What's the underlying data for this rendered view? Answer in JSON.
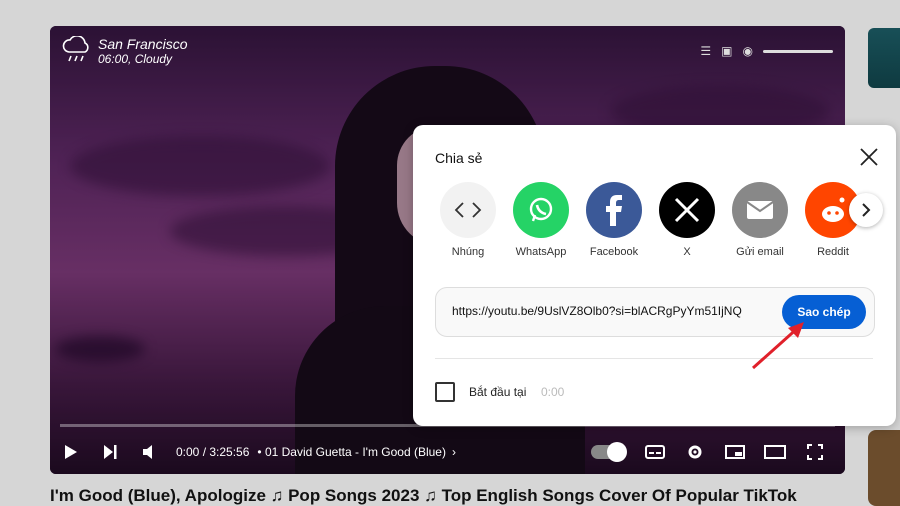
{
  "player": {
    "weather_city": "San Francisco",
    "weather_detail": "06:00, Cloudy",
    "time": "0:00 / 3:25:56",
    "chapter": "• 01 David Guetta - I'm Good (Blue)"
  },
  "video_title": "I'm Good (Blue), Apologize ♫ Pop Songs 2023 ♫ Top English Songs Cover Of Popular TikTok",
  "share": {
    "title": "Chia sẻ",
    "items": [
      {
        "label": "Nhúng",
        "icon": "embed-icon",
        "color": "#f2f2f2"
      },
      {
        "label": "WhatsApp",
        "icon": "whatsapp-icon",
        "color": "#25d366"
      },
      {
        "label": "Facebook",
        "icon": "facebook-icon",
        "color": "#3b5998"
      },
      {
        "label": "X",
        "icon": "x-icon",
        "color": "#000000"
      },
      {
        "label": "Gửi email",
        "icon": "email-icon",
        "color": "#888888"
      },
      {
        "label": "Reddit",
        "icon": "reddit-icon",
        "color": "#ff4500"
      }
    ],
    "url": "https://youtu.be/9UslVZ8Olb0?si=blACRgPyYm51IjNQ",
    "copy_label": "Sao chép",
    "start_label": "Bắt đầu tại",
    "start_time": "0:00"
  },
  "colors": {
    "accent": "#065fd4",
    "annotation_arrow": "#e0202a"
  }
}
